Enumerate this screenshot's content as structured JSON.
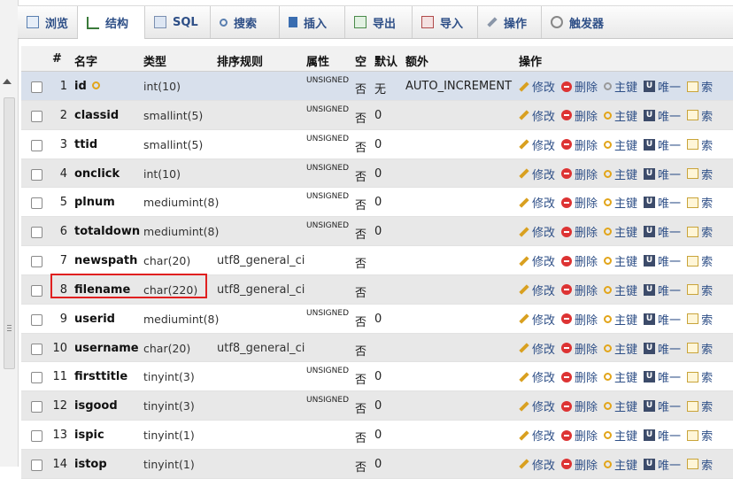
{
  "tabs": [
    {
      "label": "浏览",
      "icon": "browse-icon"
    },
    {
      "label": "结构",
      "icon": "structure-icon",
      "active": true
    },
    {
      "label": "SQL",
      "icon": "sql-icon"
    },
    {
      "label": "搜索",
      "icon": "search-icon"
    },
    {
      "label": "插入",
      "icon": "insert-icon"
    },
    {
      "label": "导出",
      "icon": "export-icon"
    },
    {
      "label": "导入",
      "icon": "import-icon"
    },
    {
      "label": "操作",
      "icon": "operations-icon"
    },
    {
      "label": "触发器",
      "icon": "triggers-icon"
    }
  ],
  "table": {
    "headers": {
      "num": "#",
      "name": "名字",
      "type": "类型",
      "collation": "排序规则",
      "attributes": "属性",
      "null": "空",
      "default": "默认",
      "extra": "额外",
      "action": "操作"
    },
    "actions": {
      "change": "修改",
      "drop": "删除",
      "primary": "主键",
      "unique": "唯一",
      "index": "索"
    },
    "rows": [
      {
        "num": "1",
        "name": "id",
        "type": "int(10)",
        "collation": "",
        "attributes": "UNSIGNED",
        "null": "否",
        "default": "无",
        "extra": "AUTO_INCREMENT",
        "primary_key": true
      },
      {
        "num": "2",
        "name": "classid",
        "type": "smallint(5)",
        "collation": "",
        "attributes": "UNSIGNED",
        "null": "否",
        "default": "0",
        "extra": ""
      },
      {
        "num": "3",
        "name": "ttid",
        "type": "smallint(5)",
        "collation": "",
        "attributes": "UNSIGNED",
        "null": "否",
        "default": "0",
        "extra": ""
      },
      {
        "num": "4",
        "name": "onclick",
        "type": "int(10)",
        "collation": "",
        "attributes": "UNSIGNED",
        "null": "否",
        "default": "0",
        "extra": ""
      },
      {
        "num": "5",
        "name": "plnum",
        "type": "mediumint(8)",
        "collation": "",
        "attributes": "UNSIGNED",
        "null": "否",
        "default": "0",
        "extra": ""
      },
      {
        "num": "6",
        "name": "totaldown",
        "type": "mediumint(8)",
        "collation": "",
        "attributes": "UNSIGNED",
        "null": "否",
        "default": "0",
        "extra": ""
      },
      {
        "num": "7",
        "name": "newspath",
        "type": "char(20)",
        "collation": "utf8_general_ci",
        "attributes": "",
        "null": "否",
        "default": "",
        "extra": ""
      },
      {
        "num": "8",
        "name": "filename",
        "type": "char(220)",
        "collation": "utf8_general_ci",
        "attributes": "",
        "null": "否",
        "default": "",
        "extra": ""
      },
      {
        "num": "9",
        "name": "userid",
        "type": "mediumint(8)",
        "collation": "",
        "attributes": "UNSIGNED",
        "null": "否",
        "default": "0",
        "extra": ""
      },
      {
        "num": "10",
        "name": "username",
        "type": "char(20)",
        "collation": "utf8_general_ci",
        "attributes": "",
        "null": "否",
        "default": "",
        "extra": ""
      },
      {
        "num": "11",
        "name": "firsttitle",
        "type": "tinyint(3)",
        "collation": "",
        "attributes": "UNSIGNED",
        "null": "否",
        "default": "0",
        "extra": ""
      },
      {
        "num": "12",
        "name": "isgood",
        "type": "tinyint(3)",
        "collation": "",
        "attributes": "UNSIGNED",
        "null": "否",
        "default": "0",
        "extra": ""
      },
      {
        "num": "13",
        "name": "ispic",
        "type": "tinyint(1)",
        "collation": "",
        "attributes": "",
        "null": "否",
        "default": "0",
        "extra": ""
      },
      {
        "num": "14",
        "name": "istop",
        "type": "tinyint(1)",
        "collation": "",
        "attributes": "",
        "null": "否",
        "default": "0",
        "extra": ""
      }
    ]
  },
  "colors": {
    "highlight": "#e02020",
    "accent": "#2e4f87"
  }
}
